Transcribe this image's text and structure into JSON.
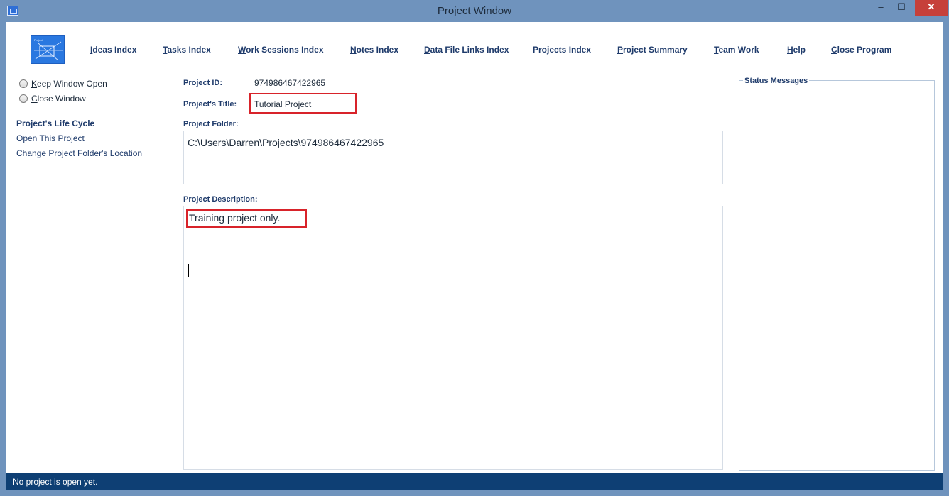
{
  "window": {
    "title": "Project Window",
    "min_glyph": "–",
    "max_glyph": "☐",
    "close_glyph": "✕"
  },
  "menu": [
    {
      "key": "I",
      "rest": "deas Index"
    },
    {
      "key": "T",
      "rest": "asks Index"
    },
    {
      "key": "W",
      "rest": "ork Sessions Index"
    },
    {
      "key": "N",
      "rest": "otes Index"
    },
    {
      "key": "D",
      "rest": "ata File Links Index"
    },
    {
      "key": "",
      "rest": "Projects Index"
    },
    {
      "key": "P",
      "rest": "roject Summary"
    },
    {
      "key": "T",
      "rest": "eam Work"
    },
    {
      "key": "H",
      "rest": "elp"
    },
    {
      "key": "C",
      "rest": "lose Program"
    }
  ],
  "radio_options": [
    {
      "key": "K",
      "rest": "eep Window Open"
    },
    {
      "key": "C",
      "rest": "lose Window"
    }
  ],
  "sidebar": {
    "heading": "Project's Life Cycle",
    "links": [
      "Open This Project",
      "Change Project Folder's Location"
    ]
  },
  "form": {
    "id_label": "Project ID:",
    "id_value": "974986467422965",
    "title_label": "Project's Title:",
    "title_value": "Tutorial Project",
    "folder_label": "Project Folder:",
    "folder_value": "C:\\Users\\Darren\\Projects\\974986467422965",
    "desc_label": "Project Description:",
    "desc_value": "Training project only."
  },
  "status_panel": {
    "title": "Status Messages"
  },
  "statusbar": {
    "text": "No project is open yet."
  },
  "colors": {
    "frame": "#6f93bd",
    "accent_text": "#1f3b6b",
    "highlight_box": "#d8232a",
    "statusbar": "#0e3f74"
  },
  "icons": {
    "app": "project-app-icon",
    "logo": "project-logo"
  }
}
